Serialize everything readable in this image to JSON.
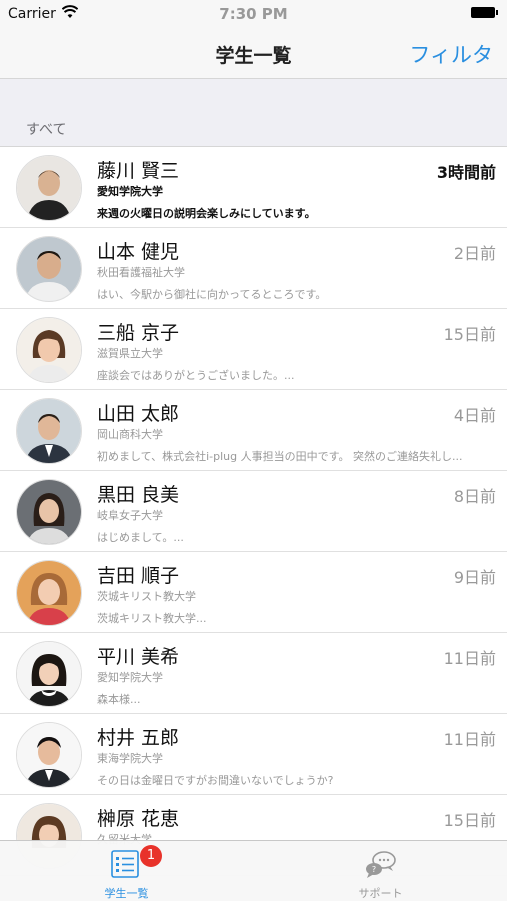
{
  "status_bar": {
    "carrier": "Carrier",
    "time": "7:30 PM"
  },
  "nav": {
    "title": "学生一覧",
    "filter_label": "フィルタ"
  },
  "section": {
    "label": "すべて"
  },
  "students": [
    {
      "name": "藤川 賢三",
      "school": "愛知学院大学",
      "preview": "来週の火曜日の説明会楽しみにしています。",
      "time": "3時間前",
      "unread": true
    },
    {
      "name": "山本 健児",
      "school": "秋田看護福祉大学",
      "preview": "はい、今駅から御社に向かってるところです。",
      "time": "2日前",
      "unread": false
    },
    {
      "name": "三船 京子",
      "school": "滋賀県立大学",
      "preview": "座談会ではありがとうございました。...",
      "time": "15日前",
      "unread": false
    },
    {
      "name": "山田 太郎",
      "school": "岡山商科大学",
      "preview": "初めまして、株式会社i-plug 人事担当の田中です。 突然のご連絡失礼し...",
      "time": "4日前",
      "unread": false
    },
    {
      "name": "黒田 良美",
      "school": "岐阜女子大学",
      "preview": "はじめまして。...",
      "time": "8日前",
      "unread": false
    },
    {
      "name": "吉田 順子",
      "school": "茨城キリスト教大学",
      "preview": "茨城キリスト教大学...",
      "time": "9日前",
      "unread": false
    },
    {
      "name": "平川 美希",
      "school": "愛知学院大学",
      "preview": "森本様...",
      "time": "11日前",
      "unread": false
    },
    {
      "name": "村井 五郎",
      "school": "東海学院大学",
      "preview": "その日は金曜日ですがお間違いないでしょうか?",
      "time": "11日前",
      "unread": false
    },
    {
      "name": "榊原 花恵",
      "school": "久留米大学",
      "preview": "",
      "time": "15日前",
      "unread": false
    }
  ],
  "tab_bar": {
    "students_label": "学生一覧",
    "support_label": "サポート",
    "badge_count": "1"
  },
  "colors": {
    "accent": "#2a8fe0",
    "badge": "#e8322a"
  }
}
